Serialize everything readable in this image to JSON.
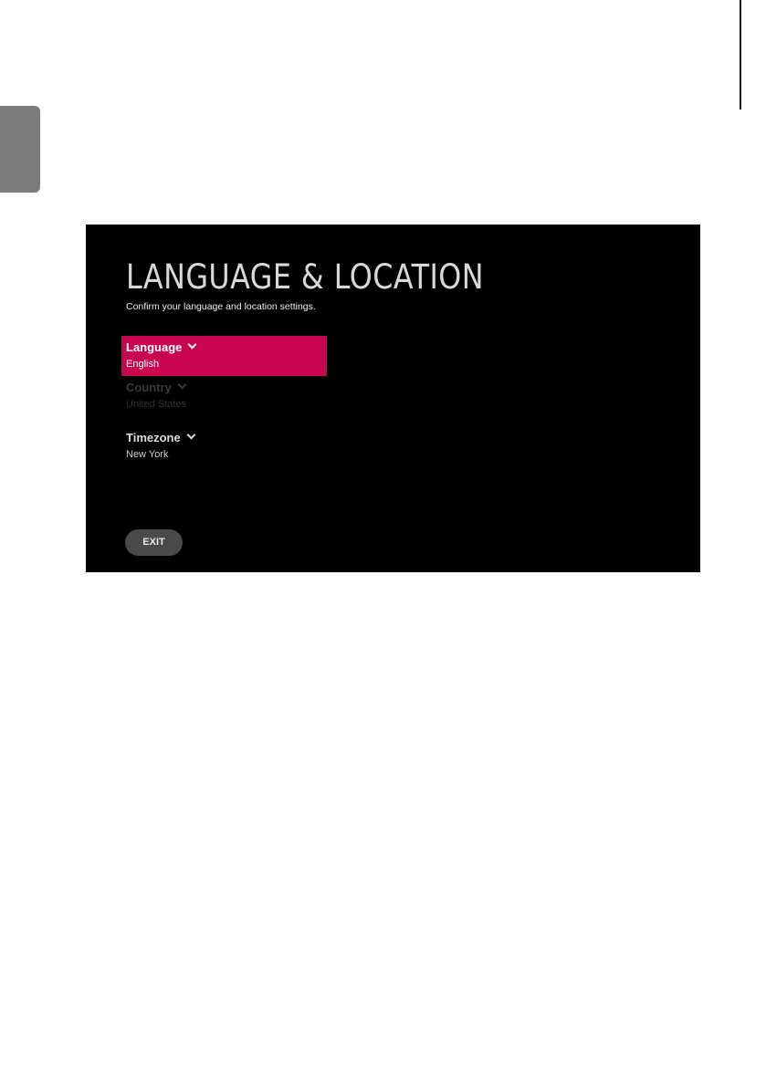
{
  "screen": {
    "title": "LANGUAGE & LOCATION",
    "subtitle": "Confirm your language and location settings.",
    "settings": [
      {
        "label": "Language",
        "value": "English",
        "state": "focused"
      },
      {
        "label": "Country",
        "value": "United States",
        "state": "disabled"
      },
      {
        "label": "Timezone",
        "value": "New York",
        "state": "normal"
      }
    ],
    "exit_label": "EXIT"
  },
  "colors": {
    "focus_highlight": "#c9054f",
    "screen_background": "#000000",
    "page_tab": "#7a7a7a"
  }
}
